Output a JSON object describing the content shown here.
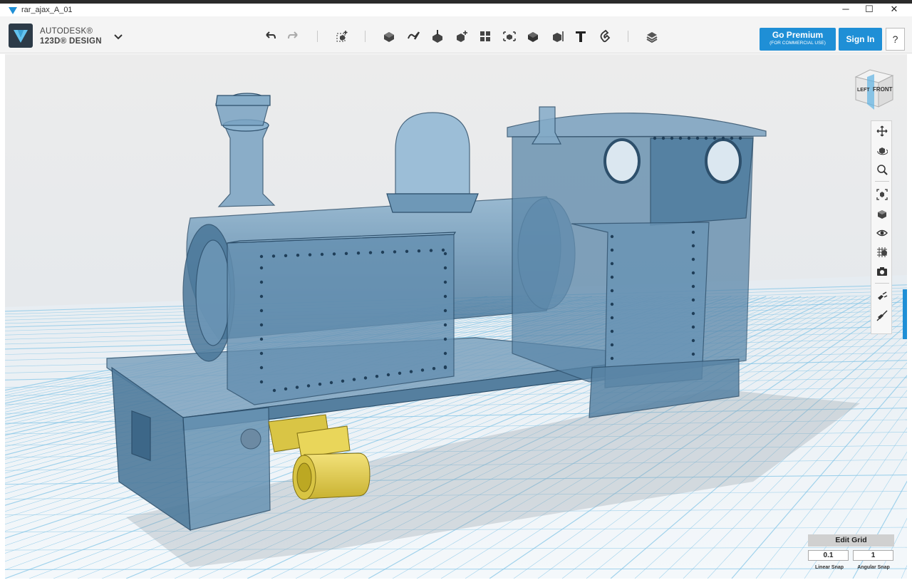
{
  "window": {
    "title": "rar_ajax_A_01",
    "minimize_glyph": "─",
    "maximize_glyph": "☐",
    "close_glyph": "✕"
  },
  "brand": {
    "line1": "AUTODESK®",
    "line2": "123D® DESIGN",
    "icon": "autodesk-123d-logo-icon"
  },
  "toolbar": {
    "tools": [
      {
        "name": "undo-icon"
      },
      {
        "name": "redo-icon"
      },
      {
        "name": "transform-icon"
      },
      {
        "name": "primitives-icon"
      },
      {
        "name": "sketch-icon"
      },
      {
        "name": "construct-icon"
      },
      {
        "name": "modify-icon"
      },
      {
        "name": "pattern-icon"
      },
      {
        "name": "group-icon"
      },
      {
        "name": "combine-icon"
      },
      {
        "name": "measure-icon"
      },
      {
        "name": "text-icon"
      },
      {
        "name": "snap-icon"
      },
      {
        "name": "material-icon"
      }
    ]
  },
  "account": {
    "premium_label": "Go Premium",
    "premium_sub": "(FOR COMMERCIAL USE)",
    "signin_label": "Sign In",
    "help_label": "?"
  },
  "viewcube": {
    "left_label": "LEFT",
    "front_label": "FRONT"
  },
  "nav_tools": [
    {
      "name": "pan-icon"
    },
    {
      "name": "orbit-icon"
    },
    {
      "name": "zoom-icon"
    },
    {
      "name": "fit-icon"
    },
    {
      "name": "view-mode-icon"
    },
    {
      "name": "visibility-eye-icon"
    },
    {
      "name": "grid-material-icon"
    },
    {
      "name": "camera-icon"
    },
    {
      "name": "snap-tool-icon"
    },
    {
      "name": "hide-snap-icon"
    }
  ],
  "grid": {
    "edit_label": "Edit Grid",
    "linear_snap_value": "0.1",
    "angular_snap_value": "1",
    "linear_snap_label": "Linear Snap",
    "angular_snap_label": "Angular Snap"
  },
  "colors": {
    "accent": "#1f8fd6",
    "model_body": "#5d88a8",
    "model_motor": "#e5d14b",
    "grid_line": "#7ec3e6"
  }
}
